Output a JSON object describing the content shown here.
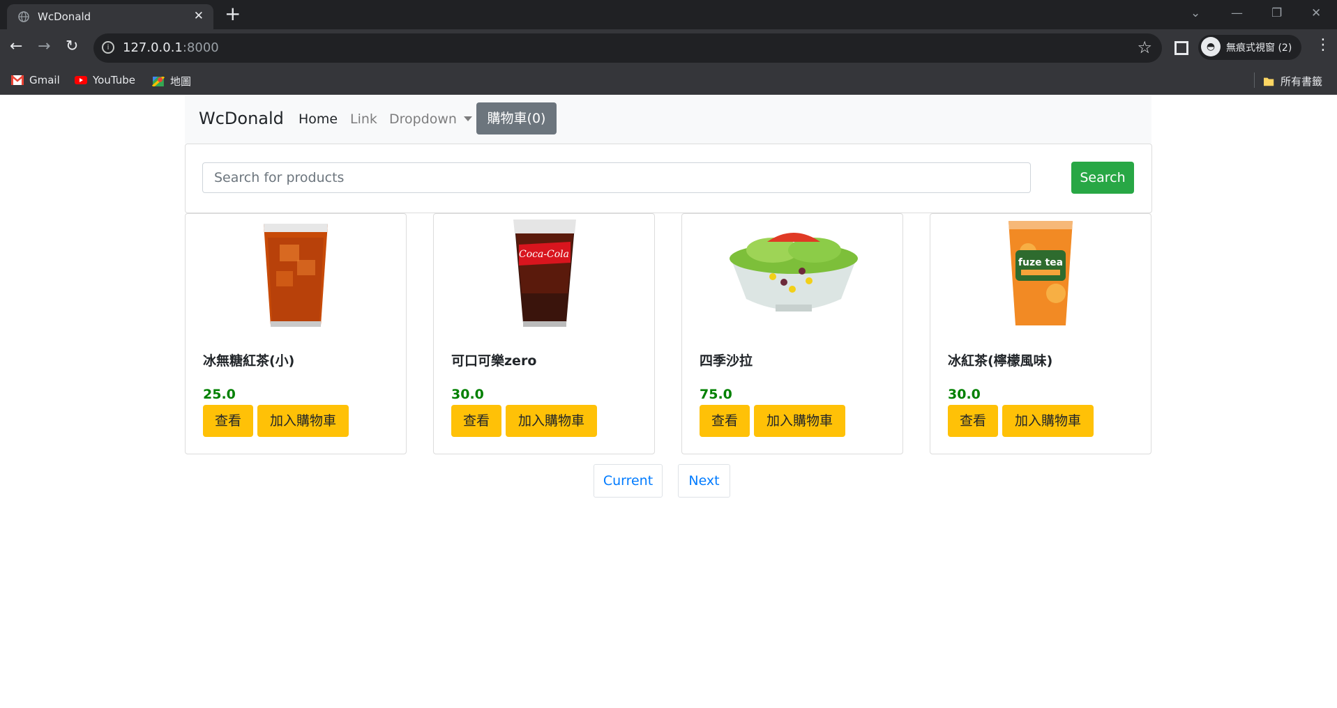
{
  "browser": {
    "tab_title": "WcDonald",
    "url_host": "127.0.0.1",
    "url_port": ":8000",
    "incognito_label": "無痕式視窗 (2)",
    "bookmarks": [
      {
        "label": "Gmail",
        "icon": "gmail-icon"
      },
      {
        "label": "YouTube",
        "icon": "youtube-icon"
      },
      {
        "label": "地圖",
        "icon": "maps-icon"
      }
    ],
    "all_bookmarks": "所有書籤"
  },
  "navbar": {
    "brand": "WcDonald",
    "links": [
      "Home",
      "Link",
      "Dropdown"
    ],
    "cart": "購物車(0)"
  },
  "search": {
    "placeholder": "Search for products",
    "button": "Search"
  },
  "products": [
    {
      "name": "冰無糖紅茶(小)",
      "price": "25.0",
      "view": "查看",
      "add": "加入購物車",
      "image": "iced-black-tea"
    },
    {
      "name": "可口可樂zero",
      "price": "30.0",
      "view": "查看",
      "add": "加入購物車",
      "image": "coca-cola-zero"
    },
    {
      "name": "四季沙拉",
      "price": "75.0",
      "view": "查看",
      "add": "加入購物車",
      "image": "garden-salad"
    },
    {
      "name": "冰紅茶(檸檬風味)",
      "price": "30.0",
      "view": "查看",
      "add": "加入購物車",
      "image": "fuze-lemon-tea"
    }
  ],
  "pagination": {
    "current": "Current",
    "next": "Next"
  },
  "colors": {
    "price": "#008000",
    "search_button": "#28a745",
    "action_button": "#ffc107",
    "cart_button": "#6c757d",
    "link": "#007bff"
  }
}
